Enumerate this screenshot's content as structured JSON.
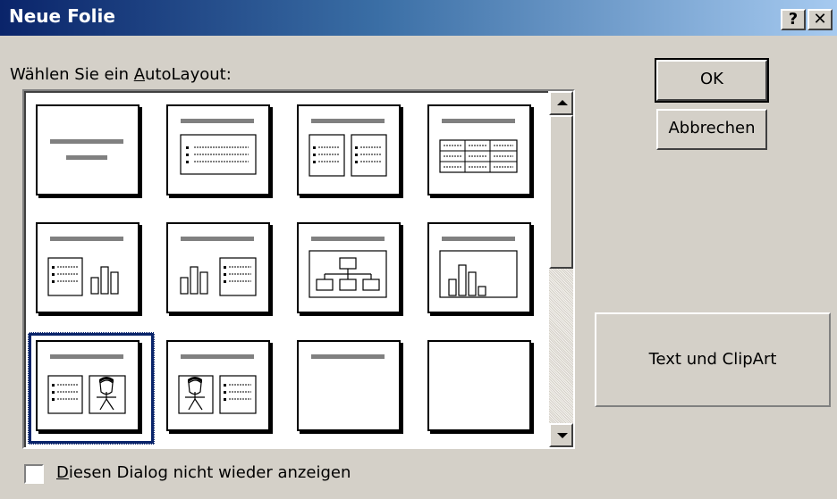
{
  "window": {
    "title": "Neue Folie",
    "help_glyph": "?",
    "close_glyph": "✕"
  },
  "layout_label": {
    "prefix": "Wählen Sie ein ",
    "underlined": "A",
    "suffix": "utoLayout:"
  },
  "buttons": {
    "ok": "OK",
    "cancel": "Abbrechen"
  },
  "preview": {
    "selected_name": "Text und ClipArt"
  },
  "checkbox": {
    "underlined": "D",
    "suffix": "iesen Dialog nicht wieder anzeigen",
    "checked": false
  },
  "layouts": [
    "title-slide",
    "bulleted-list",
    "two-column-text",
    "table",
    "text-and-chart",
    "chart-and-text",
    "organization-chart",
    "chart",
    "text-and-clipart",
    "clipart-and-text",
    "title-only",
    "blank"
  ],
  "selected_index": 8
}
